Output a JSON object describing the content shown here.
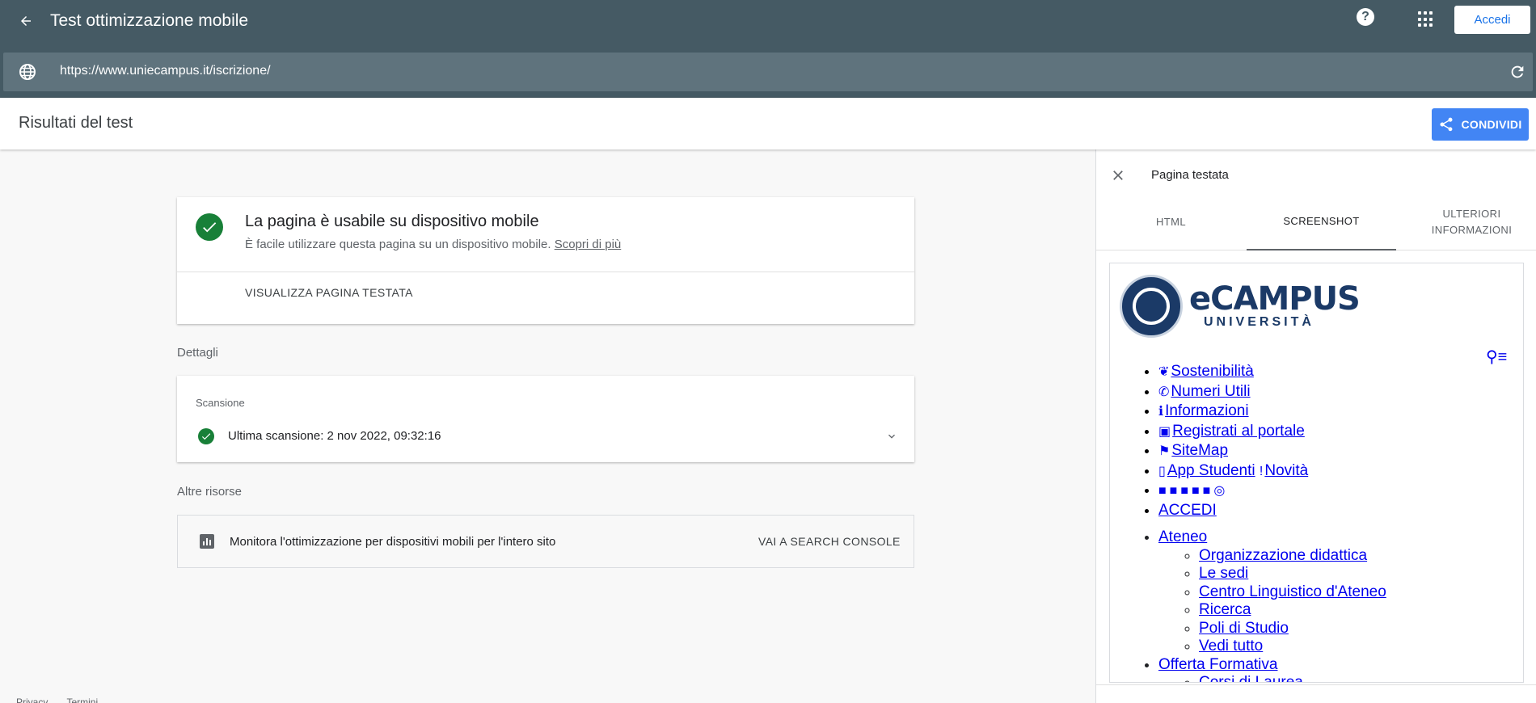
{
  "header": {
    "title": "Test ottimizzazione mobile",
    "signin_label": "Accedi",
    "url": "https://www.uniecampus.it/iscrizione/"
  },
  "results": {
    "title": "Risultati del test",
    "share_label": "CONDIVIDI"
  },
  "status_card": {
    "title": "La pagina è usabile su dispositivo mobile",
    "description": "È facile utilizzare questa pagina su un dispositivo mobile.",
    "learn_more": "Scopri di più",
    "view_button": "VISUALIZZA PAGINA TESTATA"
  },
  "details": {
    "section_label": "Dettagli",
    "scan_label": "Scansione",
    "scan_text": "Ultima scansione: 2 nov 2022, 09:32:16"
  },
  "resources": {
    "section_label": "Altre risorse",
    "text": "Monitora l'ottimizzazione per dispositivi mobili per l'intero sito",
    "button": "VAI A SEARCH CONSOLE"
  },
  "footer": {
    "privacy": "Privacy",
    "terms": "Termini"
  },
  "panel": {
    "title": "Pagina testata",
    "tabs": [
      "HTML",
      "SCREENSHOT",
      "ULTERIORI INFORMAZIONI"
    ],
    "preview": {
      "logo_main": "eCAMPUS",
      "logo_sub": "UNIVERSITÀ",
      "nav_items": [
        "Sostenibilità",
        "Numeri Utili",
        "Informazioni",
        "Registrati al portale",
        "SiteMap",
        "App Studenti",
        "Novità",
        "ACCEDI"
      ],
      "menu": {
        "ateneo": "Ateneo",
        "ateneo_items": [
          "Organizzazione didattica",
          "Le sedi",
          "Centro Linguistico d'Ateneo",
          "Ricerca",
          "Poli di Studio",
          "Vedi tutto"
        ],
        "offerta": "Offerta Formativa",
        "offerta_items": [
          "Corsi di Laurea"
        ]
      }
    }
  },
  "colors": {
    "topbar": "#455a64",
    "urlbar": "#5f737d",
    "primary": "#4285f4",
    "success": "#188038"
  }
}
